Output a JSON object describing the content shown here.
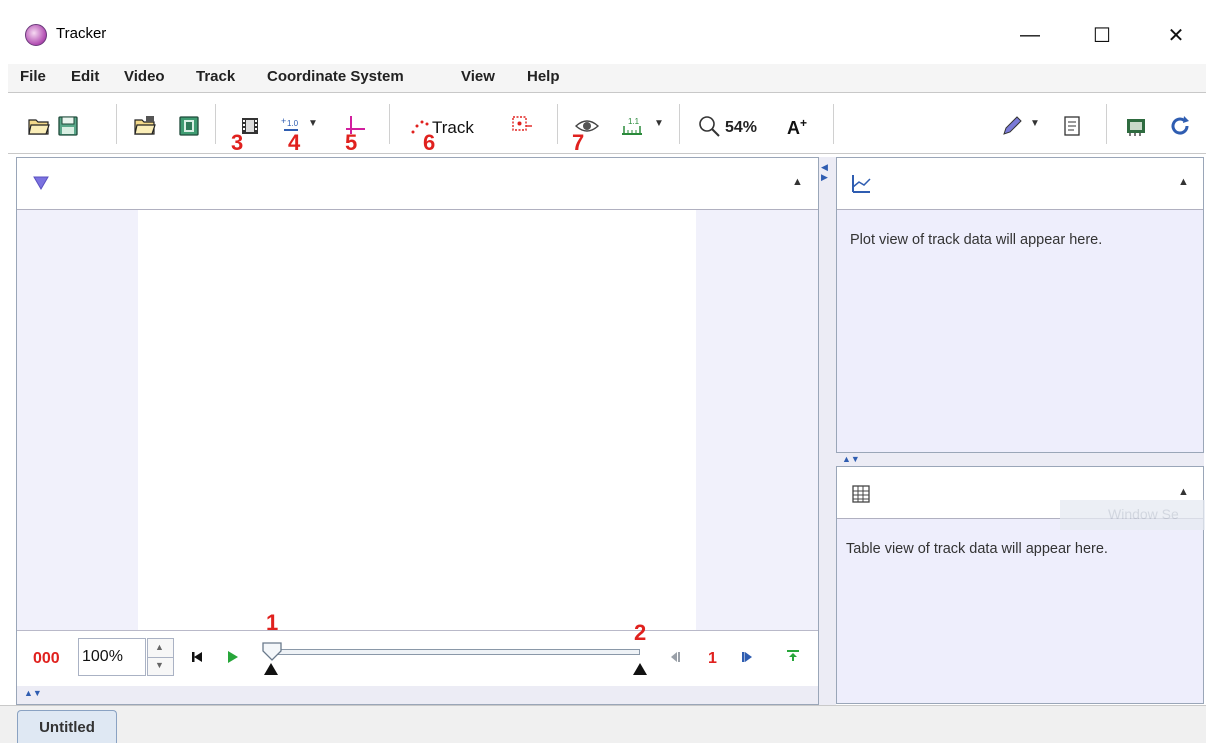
{
  "window": {
    "title": "Tracker",
    "minimize_glyph": "—",
    "maximize_glyph": "☐",
    "close_glyph": "✕"
  },
  "menu": [
    "File",
    "Edit",
    "Video",
    "Track",
    "Coordinate System",
    "View",
    "Help"
  ],
  "toolbar": {
    "track_label": "Track",
    "zoom_label": "54%",
    "font_size_label": "A+",
    "icons": [
      "open-icon",
      "save-icon",
      "open-video-icon",
      "save-video-icon",
      "clip-settings-icon",
      "calibration-tools-icon",
      "coordinate-axes-icon",
      "create-track-icon",
      "autotracker-icon",
      "visibility-icon",
      "measuring-tools-icon",
      "zoom-icon",
      "font-size-icon",
      "pencil-icon",
      "notes-icon",
      "memory-icon",
      "refresh-icon"
    ]
  },
  "annotations": {
    "a1": "1",
    "a2": "2",
    "a3": "3",
    "a4": "4",
    "a5": "5",
    "a6": "6",
    "a7": "7"
  },
  "plot_panel": {
    "placeholder": "Plot view of track data will appear here."
  },
  "table_panel": {
    "placeholder": "Table view of track data will appear here."
  },
  "player": {
    "frame_counter": "000",
    "rate": "100%",
    "step_size": "1"
  },
  "tabs": {
    "active": "Untitled"
  },
  "watermark": "Window Se",
  "colors": {
    "annotation_red": "#e0211e",
    "panel_lavender": "#eeeefc",
    "accent_blue": "#2f5db1",
    "axis_magenta": "#d21f9e"
  }
}
